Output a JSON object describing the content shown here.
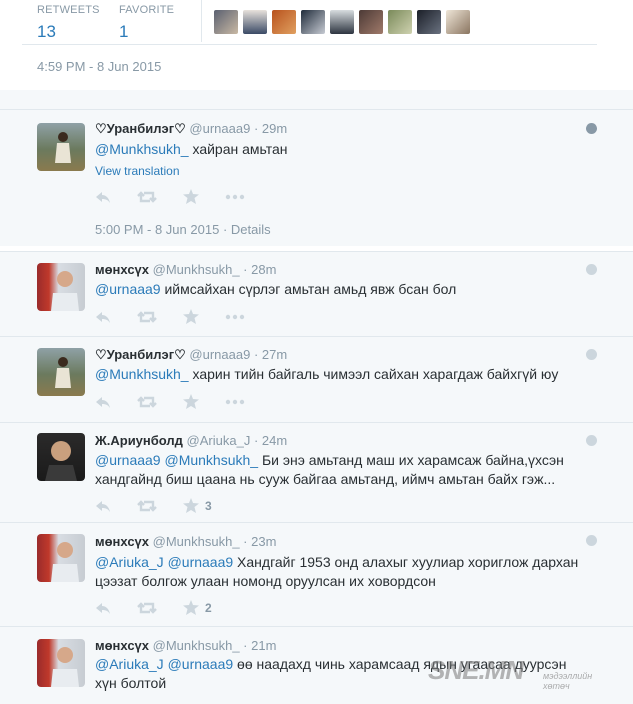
{
  "stats": {
    "retweets_label": "RETWEETS",
    "retweets": "13",
    "favorites_label": "FAVORITE",
    "favorites": "1"
  },
  "timestamp": "4:59 PM - 8 Jun 2015",
  "colors": {
    "link": "#2b7bb9",
    "muted": "#8899a6",
    "reply_bg": "#f5f8fa"
  },
  "replies": [
    {
      "name": "♡Уранбилэг♡",
      "handle": "@urnaaa9",
      "sep": "·",
      "time": "29m",
      "mentions": "@Munkhsukh_",
      "text": " хайран амьтан",
      "view_translation": "View translation",
      "details_time": "5:00 PM - 8 Jun 2015",
      "details_sep": "·",
      "details": "Details"
    },
    {
      "name": "мөнхсүх",
      "handle": "@Munkhsukh_",
      "sep": "·",
      "time": "28m",
      "mentions": "@urnaaa9",
      "text": " иймсайхан сүрлэг амьтан амьд явж бсан бол"
    },
    {
      "name": "♡Уранбилэг♡",
      "handle": "@urnaaa9",
      "sep": "·",
      "time": "27m",
      "mentions": "@Munkhsukh_",
      "text": "  харин тийн  байгаль чимээл сайхан  харагдаж байхгүй юу"
    },
    {
      "name": "Ж.Ариунболд",
      "handle": "@Ariuka_J",
      "sep": "·",
      "time": "24m",
      "mentions": "@urnaaa9 @Munkhsukh_",
      "text": " Би энэ амьтанд маш их харамсаж байна,үхсэн хандгайнд биш цаана нь сууж байгаа амьтанд, иймч амьтан байх гэж...",
      "fav_count": "3"
    },
    {
      "name": "мөнхсүх",
      "handle": "@Munkhsukh_",
      "sep": "·",
      "time": "23m",
      "mentions": "@Ariuka_J @urnaaa9",
      "text": " Хандгайг 1953 онд алахыг хуулиар хориглож дархан цээзат болгож улаан номонд оруулсан их ховордсон",
      "fav_count": "2"
    },
    {
      "name": "мөнхсүх",
      "handle": "@Munkhsukh_",
      "sep": "·",
      "time": "21m",
      "mentions": "@Ariuka_J @urnaaa9",
      "text": " өө наадахд чинь харамсаад ядын угаасаа дуурсэн хүн болтой"
    }
  ],
  "icons": [
    "reply-icon",
    "retweet-icon",
    "favorite-icon",
    "more-icon",
    "globe-icon"
  ],
  "watermark": {
    "logo": "SNE.MN",
    "sub1": "мэдээллийн",
    "sub2": "хөтөч"
  }
}
